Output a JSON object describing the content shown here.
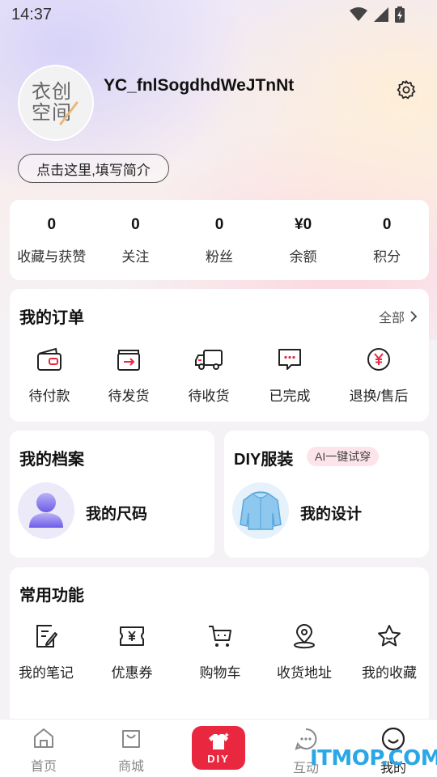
{
  "status_bar": {
    "time": "14:37"
  },
  "profile": {
    "username": "YC_fnlSogdhdWeJTnNt",
    "avatar_text_line1": "衣创",
    "avatar_text_line2": "空间",
    "bio_button": "点击这里,填写简介"
  },
  "stats": [
    {
      "value": "0",
      "label": "收藏与获赞"
    },
    {
      "value": "0",
      "label": "关注"
    },
    {
      "value": "0",
      "label": "粉丝"
    },
    {
      "value": "¥0",
      "label": "余额"
    },
    {
      "value": "0",
      "label": "积分"
    }
  ],
  "orders": {
    "title": "我的订单",
    "see_all": "全部",
    "items": [
      {
        "label": "待付款",
        "icon": "wallet-icon"
      },
      {
        "label": "待发货",
        "icon": "box-arrow-icon"
      },
      {
        "label": "待收货",
        "icon": "truck-icon"
      },
      {
        "label": "已完成",
        "icon": "chat-dots-icon"
      },
      {
        "label": "退换/售后",
        "icon": "yen-circle-icon"
      }
    ]
  },
  "archive": {
    "title": "我的档案",
    "item_label": "我的尺码"
  },
  "diy_card": {
    "title": "DIY服装",
    "badge": "AI一键试穿",
    "item_label": "我的设计"
  },
  "functions": {
    "title": "常用功能",
    "items": [
      {
        "label": "我的笔记",
        "icon": "note-edit-icon"
      },
      {
        "label": "优惠券",
        "icon": "coupon-icon"
      },
      {
        "label": "购物车",
        "icon": "cart-icon"
      },
      {
        "label": "收货地址",
        "icon": "location-pin-icon"
      },
      {
        "label": "我的收藏",
        "icon": "star-icon"
      }
    ]
  },
  "tab_bar": [
    {
      "label": "首页",
      "icon": "home-icon"
    },
    {
      "label": "商城",
      "icon": "bag-icon"
    },
    {
      "label": "DIY",
      "icon": "diy-shirt-icon"
    },
    {
      "label": "互动",
      "icon": "chat-icon"
    },
    {
      "label": "我的",
      "icon": "profile-icon"
    }
  ],
  "watermark": "ITMOP.COM",
  "colors": {
    "accent": "#e9283f",
    "badge_bg": "#fde4ea",
    "watermark": "#2aa7e6"
  }
}
